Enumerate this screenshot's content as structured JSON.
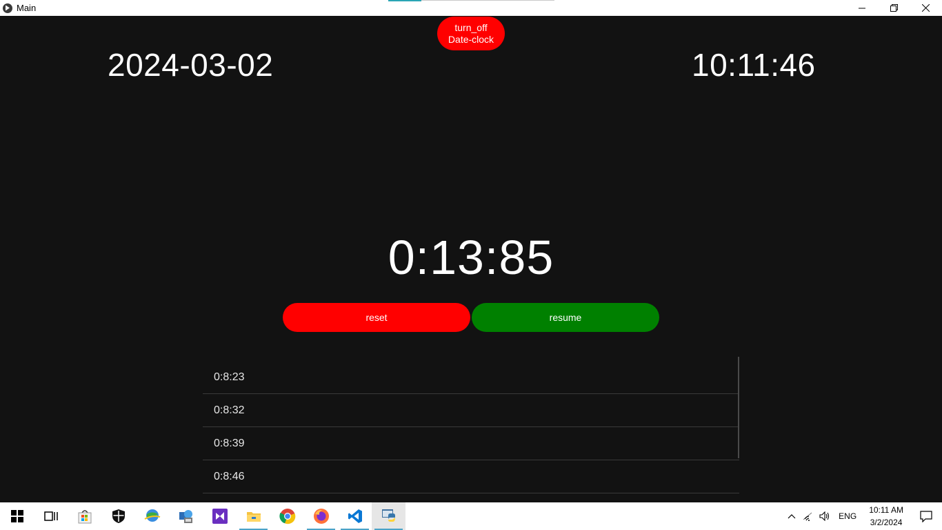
{
  "window": {
    "title": "Main"
  },
  "header": {
    "turn_off_line1": "turn_off",
    "turn_off_line2": "Date-clock",
    "date": "2024-03-02",
    "time": "10:11:46"
  },
  "stopwatch": {
    "value": "0:13:85",
    "reset_label": "reset",
    "resume_label": "resume"
  },
  "laps": [
    "0:8:23",
    "0:8:32",
    "0:8:39",
    "0:8:46"
  ],
  "taskbar": {
    "apps": [
      "start",
      "task-view",
      "microsoft-store",
      "windows-security",
      "internet-download-manager",
      "network-app",
      "visual-studio",
      "file-explorer",
      "chrome",
      "firefox",
      "vscode",
      "python"
    ],
    "language": "ENG",
    "clock_time": "10:11 AM",
    "clock_date": "3/2/2024"
  },
  "colors": {
    "background": "#121212",
    "reset": "#ff0000",
    "resume": "#008000",
    "turn_off": "#ff0000"
  }
}
